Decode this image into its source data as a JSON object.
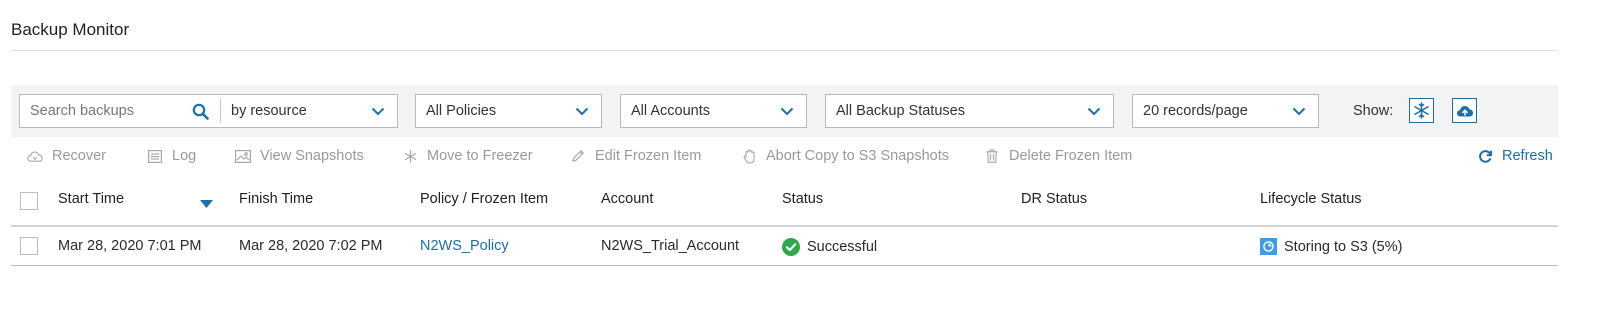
{
  "page": {
    "title": "Backup Monitor"
  },
  "filters": {
    "search_placeholder": "Search backups",
    "search_scope": "by resource",
    "policies": "All Policies",
    "accounts": "All Accounts",
    "statuses": "All Backup Statuses",
    "records_per_page": "20 records/page",
    "show_label": "Show:"
  },
  "toolbar": {
    "recover": "Recover",
    "log": "Log",
    "view_snapshots": "View Snapshots",
    "move_to_freezer": "Move to Freezer",
    "edit_frozen_item": "Edit Frozen Item",
    "abort_copy": "Abort Copy to S3 Snapshots",
    "delete_frozen_item": "Delete Frozen Item",
    "refresh": "Refresh"
  },
  "table": {
    "columns": [
      "Start Time",
      "Finish Time",
      "Policy / Frozen Item",
      "Account",
      "Status",
      "DR Status",
      "Lifecycle Status"
    ],
    "rows": [
      {
        "start_time": "Mar 28, 2020 7:01 PM",
        "finish_time": "Mar 28, 2020 7:02 PM",
        "policy": "N2WS_Policy",
        "account": "N2WS_Trial_Account",
        "status": "Successful",
        "dr_status": "",
        "lifecycle_status": "Storing to S3 (5%)"
      }
    ]
  },
  "icons": {
    "search": "search-icon",
    "chevron": "chevron-down-icon",
    "freezer_toggle": "snowflake-icon",
    "s3_toggle": "cloud-upload-icon",
    "status_ok": "check-circle-icon",
    "lifecycle": "s3-storage-icon",
    "sort": "sort-desc-icon"
  },
  "colors": {
    "accent": "#1d6fa5",
    "success": "#2ea84a",
    "disabled": "#9a9a9a",
    "lifecycle": "#3d9be9"
  }
}
